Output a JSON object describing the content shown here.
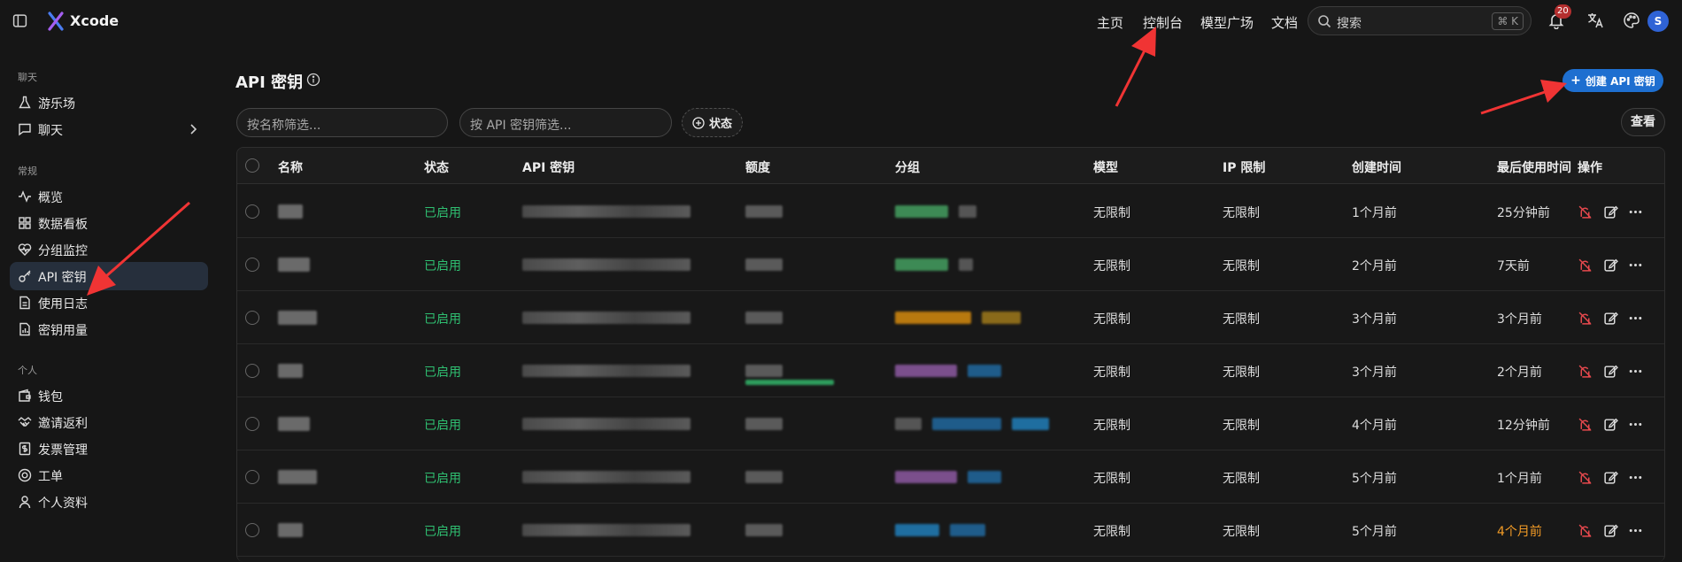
{
  "app": {
    "brand": "Xcode"
  },
  "topnav": {
    "items": [
      "主页",
      "控制台",
      "模型广场",
      "文档"
    ],
    "search_placeholder": "搜索",
    "search_shortcut": "⌘ K",
    "notification_count": "20",
    "avatar_initial": "S"
  },
  "sidebar": {
    "sections": [
      {
        "label": "聊天",
        "items": [
          "游乐场",
          "聊天"
        ]
      },
      {
        "label": "常规",
        "items": [
          "概览",
          "数据看板",
          "分组监控",
          "API 密钥",
          "使用日志",
          "密钥用量"
        ]
      },
      {
        "label": "个人",
        "items": [
          "钱包",
          "邀请返利",
          "发票管理",
          "工单",
          "个人资料"
        ]
      }
    ],
    "active_item": "API 密钥"
  },
  "main": {
    "title": "API 密钥",
    "create_button": "创建 API 密钥",
    "filter_name_placeholder": "按名称筛选...",
    "filter_key_placeholder": "按 API 密钥筛选...",
    "status_filter": "状态",
    "view_button": "查看"
  },
  "table": {
    "columns": [
      "名称",
      "状态",
      "API 密钥",
      "额度",
      "分组",
      "模型",
      "IP 限制",
      "创建时间",
      "最后使用时间",
      "操作"
    ],
    "rows": [
      {
        "status": "已启用",
        "model": "无限制",
        "ip": "无限制",
        "created": "1个月前",
        "last_used": "25分钟前",
        "last_used_warn": false
      },
      {
        "status": "已启用",
        "model": "无限制",
        "ip": "无限制",
        "created": "2个月前",
        "last_used": "7天前",
        "last_used_warn": false
      },
      {
        "status": "已启用",
        "model": "无限制",
        "ip": "无限制",
        "created": "3个月前",
        "last_used": "3个月前",
        "last_used_warn": false
      },
      {
        "status": "已启用",
        "model": "无限制",
        "ip": "无限制",
        "created": "3个月前",
        "last_used": "2个月前",
        "last_used_warn": false
      },
      {
        "status": "已启用",
        "model": "无限制",
        "ip": "无限制",
        "created": "4个月前",
        "last_used": "12分钟前",
        "last_used_warn": false
      },
      {
        "status": "已启用",
        "model": "无限制",
        "ip": "无限制",
        "created": "5个月前",
        "last_used": "1个月前",
        "last_used_warn": false
      },
      {
        "status": "已启用",
        "model": "无限制",
        "ip": "无限制",
        "created": "5个月前",
        "last_used": "4个月前",
        "last_used_warn": true
      }
    ]
  },
  "colors": {
    "accent": "#1e6fd0",
    "enabled": "#2fbf71",
    "warning": "#f29b26",
    "annotation_arrow": "#f03434",
    "action_disable": "#e5484d"
  }
}
